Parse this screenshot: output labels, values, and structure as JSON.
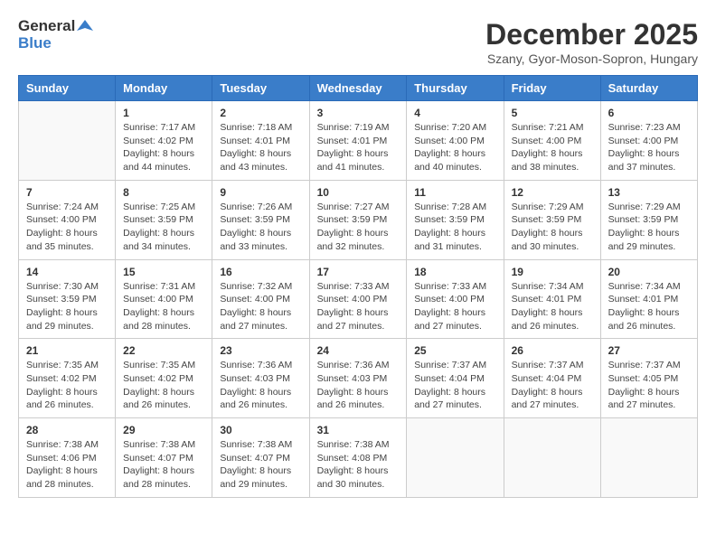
{
  "header": {
    "logo_general": "General",
    "logo_blue": "Blue",
    "month_title": "December 2025",
    "location": "Szany, Gyor-Moson-Sopron, Hungary"
  },
  "days_of_week": [
    "Sunday",
    "Monday",
    "Tuesday",
    "Wednesday",
    "Thursday",
    "Friday",
    "Saturday"
  ],
  "weeks": [
    [
      {
        "day": "",
        "info": ""
      },
      {
        "day": "1",
        "info": "Sunrise: 7:17 AM\nSunset: 4:02 PM\nDaylight: 8 hours\nand 44 minutes."
      },
      {
        "day": "2",
        "info": "Sunrise: 7:18 AM\nSunset: 4:01 PM\nDaylight: 8 hours\nand 43 minutes."
      },
      {
        "day": "3",
        "info": "Sunrise: 7:19 AM\nSunset: 4:01 PM\nDaylight: 8 hours\nand 41 minutes."
      },
      {
        "day": "4",
        "info": "Sunrise: 7:20 AM\nSunset: 4:00 PM\nDaylight: 8 hours\nand 40 minutes."
      },
      {
        "day": "5",
        "info": "Sunrise: 7:21 AM\nSunset: 4:00 PM\nDaylight: 8 hours\nand 38 minutes."
      },
      {
        "day": "6",
        "info": "Sunrise: 7:23 AM\nSunset: 4:00 PM\nDaylight: 8 hours\nand 37 minutes."
      }
    ],
    [
      {
        "day": "7",
        "info": "Sunrise: 7:24 AM\nSunset: 4:00 PM\nDaylight: 8 hours\nand 35 minutes."
      },
      {
        "day": "8",
        "info": "Sunrise: 7:25 AM\nSunset: 3:59 PM\nDaylight: 8 hours\nand 34 minutes."
      },
      {
        "day": "9",
        "info": "Sunrise: 7:26 AM\nSunset: 3:59 PM\nDaylight: 8 hours\nand 33 minutes."
      },
      {
        "day": "10",
        "info": "Sunrise: 7:27 AM\nSunset: 3:59 PM\nDaylight: 8 hours\nand 32 minutes."
      },
      {
        "day": "11",
        "info": "Sunrise: 7:28 AM\nSunset: 3:59 PM\nDaylight: 8 hours\nand 31 minutes."
      },
      {
        "day": "12",
        "info": "Sunrise: 7:29 AM\nSunset: 3:59 PM\nDaylight: 8 hours\nand 30 minutes."
      },
      {
        "day": "13",
        "info": "Sunrise: 7:29 AM\nSunset: 3:59 PM\nDaylight: 8 hours\nand 29 minutes."
      }
    ],
    [
      {
        "day": "14",
        "info": "Sunrise: 7:30 AM\nSunset: 3:59 PM\nDaylight: 8 hours\nand 29 minutes."
      },
      {
        "day": "15",
        "info": "Sunrise: 7:31 AM\nSunset: 4:00 PM\nDaylight: 8 hours\nand 28 minutes."
      },
      {
        "day": "16",
        "info": "Sunrise: 7:32 AM\nSunset: 4:00 PM\nDaylight: 8 hours\nand 27 minutes."
      },
      {
        "day": "17",
        "info": "Sunrise: 7:33 AM\nSunset: 4:00 PM\nDaylight: 8 hours\nand 27 minutes."
      },
      {
        "day": "18",
        "info": "Sunrise: 7:33 AM\nSunset: 4:00 PM\nDaylight: 8 hours\nand 27 minutes."
      },
      {
        "day": "19",
        "info": "Sunrise: 7:34 AM\nSunset: 4:01 PM\nDaylight: 8 hours\nand 26 minutes."
      },
      {
        "day": "20",
        "info": "Sunrise: 7:34 AM\nSunset: 4:01 PM\nDaylight: 8 hours\nand 26 minutes."
      }
    ],
    [
      {
        "day": "21",
        "info": "Sunrise: 7:35 AM\nSunset: 4:02 PM\nDaylight: 8 hours\nand 26 minutes."
      },
      {
        "day": "22",
        "info": "Sunrise: 7:35 AM\nSunset: 4:02 PM\nDaylight: 8 hours\nand 26 minutes."
      },
      {
        "day": "23",
        "info": "Sunrise: 7:36 AM\nSunset: 4:03 PM\nDaylight: 8 hours\nand 26 minutes."
      },
      {
        "day": "24",
        "info": "Sunrise: 7:36 AM\nSunset: 4:03 PM\nDaylight: 8 hours\nand 26 minutes."
      },
      {
        "day": "25",
        "info": "Sunrise: 7:37 AM\nSunset: 4:04 PM\nDaylight: 8 hours\nand 27 minutes."
      },
      {
        "day": "26",
        "info": "Sunrise: 7:37 AM\nSunset: 4:04 PM\nDaylight: 8 hours\nand 27 minutes."
      },
      {
        "day": "27",
        "info": "Sunrise: 7:37 AM\nSunset: 4:05 PM\nDaylight: 8 hours\nand 27 minutes."
      }
    ],
    [
      {
        "day": "28",
        "info": "Sunrise: 7:38 AM\nSunset: 4:06 PM\nDaylight: 8 hours\nand 28 minutes."
      },
      {
        "day": "29",
        "info": "Sunrise: 7:38 AM\nSunset: 4:07 PM\nDaylight: 8 hours\nand 28 minutes."
      },
      {
        "day": "30",
        "info": "Sunrise: 7:38 AM\nSunset: 4:07 PM\nDaylight: 8 hours\nand 29 minutes."
      },
      {
        "day": "31",
        "info": "Sunrise: 7:38 AM\nSunset: 4:08 PM\nDaylight: 8 hours\nand 30 minutes."
      },
      {
        "day": "",
        "info": ""
      },
      {
        "day": "",
        "info": ""
      },
      {
        "day": "",
        "info": ""
      }
    ]
  ]
}
